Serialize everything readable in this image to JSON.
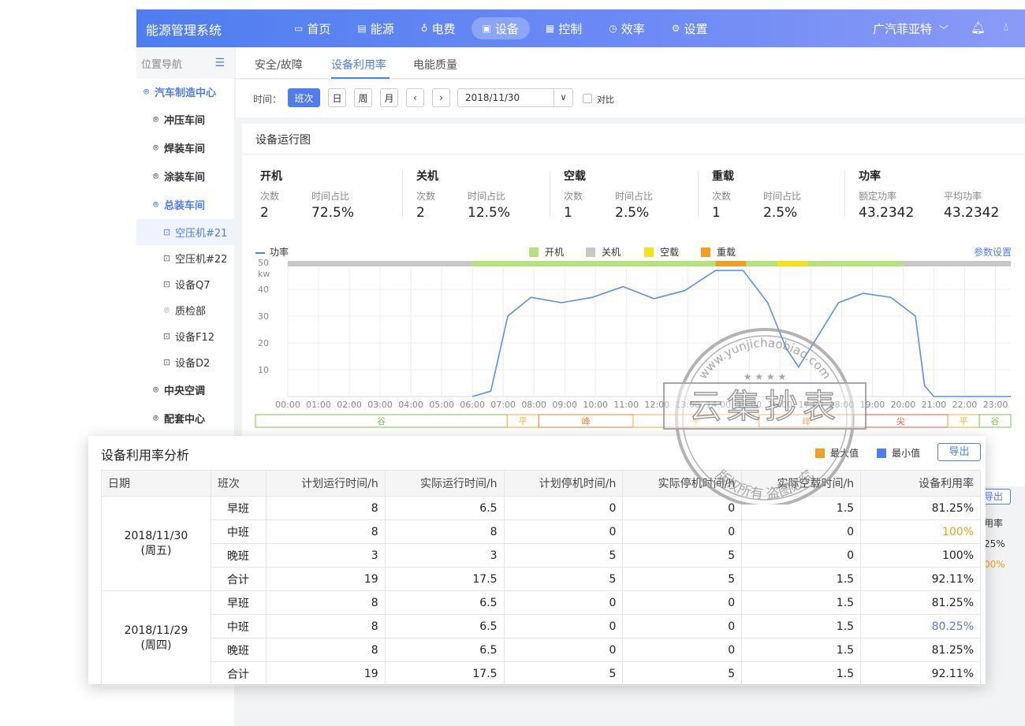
{
  "app": {
    "title": "能源管理系统",
    "nav": [
      {
        "label": "首页",
        "icon": "monitor-icon",
        "glyph": "▭"
      },
      {
        "label": "能源",
        "icon": "database-icon",
        "glyph": "▤"
      },
      {
        "label": "电费",
        "icon": "lightbulb-icon",
        "glyph": "♁"
      },
      {
        "label": "设备",
        "icon": "device-icon",
        "glyph": "▣"
      },
      {
        "label": "控制",
        "icon": "control-panel-icon",
        "glyph": "▦"
      },
      {
        "label": "效率",
        "icon": "clock-icon",
        "glyph": "◷"
      },
      {
        "label": "设置",
        "icon": "gear-icon",
        "glyph": "⚙"
      }
    ],
    "active_nav": "设备",
    "company": "广汽菲亚特",
    "company_caret": "﹀"
  },
  "sidebar": {
    "header": "位置导航",
    "collapse_glyph": "☰",
    "items": [
      {
        "label": "汽车制造中心",
        "type": "location"
      },
      {
        "label": "冲压车间",
        "type": "location"
      },
      {
        "label": "焊装车间",
        "type": "location"
      },
      {
        "label": "涂装车间",
        "type": "location"
      },
      {
        "label": "总装车间",
        "type": "location"
      },
      {
        "label": "空压机#21",
        "type": "device"
      },
      {
        "label": "空压机#22",
        "type": "device"
      },
      {
        "label": "设备Q7",
        "type": "device"
      },
      {
        "label": "质检部",
        "type": "location"
      },
      {
        "label": "设备F12",
        "type": "device"
      },
      {
        "label": "设备D2",
        "type": "device"
      },
      {
        "label": "中央空调",
        "type": "location"
      },
      {
        "label": "配套中心",
        "type": "location"
      }
    ]
  },
  "tabs": [
    "安全/故障",
    "设备利用率",
    "电能质量"
  ],
  "active_tab": "设备利用率",
  "filter": {
    "label": "时间：",
    "buttons": [
      "班次",
      "日",
      "周",
      "月"
    ],
    "active": "班次",
    "prev": "‹",
    "next": "›",
    "date": "2018/11/30",
    "date_caret": "∨",
    "compare_label": "对比"
  },
  "run_card": {
    "title": "设备运行图",
    "stats": [
      {
        "title": "开机",
        "sub1": "次数",
        "sub2": "时间占比",
        "val1": "2",
        "val2": "72.5%"
      },
      {
        "title": "关机",
        "sub1": "次数",
        "sub2": "时间占比",
        "val1": "2",
        "val2": "12.5%"
      },
      {
        "title": "空载",
        "sub1": "次数",
        "sub2": "时间占比",
        "val1": "1",
        "val2": "2.5%"
      },
      {
        "title": "重载",
        "sub1": "次数",
        "sub2": "时间占比",
        "val1": "1",
        "val2": "2.5%"
      },
      {
        "title": "功率",
        "sub1": "额定功率",
        "sub2": "平均功率",
        "val1": "43.2342",
        "val2": "43.2342"
      }
    ],
    "legend_power": "功率",
    "legend_states": [
      {
        "label": "开机",
        "color": "#b5e27c"
      },
      {
        "label": "关机",
        "color": "#c8c8c8"
      },
      {
        "label": "空载",
        "color": "#f6e21a"
      },
      {
        "label": "重载",
        "color": "#f0a020"
      }
    ],
    "param_link": "参数设置"
  },
  "chart_data": {
    "type": "line",
    "title": "设备运行图",
    "ylabel": "kw",
    "ylim": [
      0,
      50
    ],
    "yticks": [
      10,
      20,
      30,
      40,
      50
    ],
    "x": [
      "00:00",
      "01:00",
      "02:00",
      "03:00",
      "04:00",
      "05:00",
      "06:00",
      "07:00",
      "08:00",
      "09:00",
      "10:00",
      "11:00",
      "12:00",
      "13:00",
      "14:00",
      "15:00",
      "16:00",
      "17:00",
      "18:00",
      "19:00",
      "20:00",
      "21:00",
      "22:00",
      "23:00"
    ],
    "series": [
      {
        "name": "功率",
        "color": "#5b8ff0",
        "points": [
          [
            6.0,
            0
          ],
          [
            6.6,
            2
          ],
          [
            7.15,
            30
          ],
          [
            7.9,
            37
          ],
          [
            8.9,
            35
          ],
          [
            9.9,
            37
          ],
          [
            10.9,
            41
          ],
          [
            11.9,
            36.5
          ],
          [
            12.9,
            39.5
          ],
          [
            13.9,
            47
          ],
          [
            14.8,
            47
          ],
          [
            15.6,
            35
          ],
          [
            16.2,
            18
          ],
          [
            16.6,
            11
          ],
          [
            17.2,
            22
          ],
          [
            17.9,
            35
          ],
          [
            18.7,
            38.5
          ],
          [
            19.6,
            37
          ],
          [
            20.4,
            30
          ],
          [
            20.7,
            4
          ],
          [
            21,
            0
          ],
          [
            23.5,
            0
          ]
        ]
      }
    ],
    "state_bar": [
      {
        "state": "关机",
        "from": 0,
        "to": 6.0
      },
      {
        "state": "开机",
        "from": 6.0,
        "to": 13.9
      },
      {
        "state": "重载",
        "from": 13.9,
        "to": 14.9
      },
      {
        "state": "开机",
        "from": 14.9,
        "to": 15.9
      },
      {
        "state": "空载",
        "from": 15.9,
        "to": 16.9
      },
      {
        "state": "开机",
        "from": 16.9,
        "to": 20.0
      },
      {
        "state": "关机",
        "from": 20.0,
        "to": 23.5
      }
    ],
    "tariff_bands": [
      {
        "label": "谷",
        "from": 0,
        "to": 8,
        "color": "#7cc44a"
      },
      {
        "label": "平",
        "from": 8,
        "to": 9,
        "color": "#f0b030"
      },
      {
        "label": "峰",
        "from": 9,
        "to": 12,
        "color": "#f08030"
      },
      {
        "label": "平",
        "from": 12,
        "to": 16,
        "color": "#f0b030"
      },
      {
        "label": "峰",
        "from": 16,
        "to": 19,
        "color": "#f08030"
      },
      {
        "label": "尖",
        "from": 19,
        "to": 22,
        "color": "#e45a4a"
      },
      {
        "label": "平",
        "from": 22,
        "to": 23,
        "color": "#f0b030"
      },
      {
        "label": "谷",
        "from": 23,
        "to": 24,
        "color": "#7cc44a"
      }
    ]
  },
  "utilization": {
    "title": "设备利用率分析",
    "legend": [
      {
        "label": "最大值",
        "color": "#f0a020"
      },
      {
        "label": "最小值",
        "color": "#4f7df0"
      }
    ],
    "export_label": "导出",
    "columns": [
      "日期",
      "班次",
      "计划运行时间/h",
      "实际运行时间/h",
      "计划停机时间/h",
      "实际停机时间/h",
      "实际空载时间/h",
      "设备利用率"
    ],
    "groups": [
      {
        "date": "2018/11/30",
        "weekday": "(周五)",
        "rows": [
          {
            "shift": "早班",
            "vals": [
              "8",
              "6.5",
              "0",
              "0",
              "1.5"
            ],
            "rate": "81.25%",
            "mark": ""
          },
          {
            "shift": "中班",
            "vals": [
              "8",
              "8",
              "0",
              "0",
              "0"
            ],
            "rate": "100%",
            "mark": "max"
          },
          {
            "shift": "晚班",
            "vals": [
              "3",
              "3",
              "5",
              "5",
              "0"
            ],
            "rate": "100%",
            "mark": ""
          },
          {
            "shift": "合计",
            "vals": [
              "19",
              "17.5",
              "5",
              "5",
              "1.5"
            ],
            "rate": "92.11%",
            "mark": ""
          }
        ]
      },
      {
        "date": "2018/11/29",
        "weekday": "(周四)",
        "rows": [
          {
            "shift": "早班",
            "vals": [
              "8",
              "6.5",
              "0",
              "0",
              "1.5"
            ],
            "rate": "81.25%",
            "mark": ""
          },
          {
            "shift": "中班",
            "vals": [
              "8",
              "6.5",
              "0",
              "0",
              "1.5"
            ],
            "rate": "80.25%",
            "mark": "min"
          },
          {
            "shift": "晚班",
            "vals": [
              "8",
              "6.5",
              "0",
              "0",
              "1.5"
            ],
            "rate": "81.25%",
            "mark": ""
          },
          {
            "shift": "合计",
            "vals": [
              "19",
              "17.5",
              "5",
              "5",
              "1.5"
            ],
            "rate": "92.11%",
            "mark": ""
          }
        ]
      }
    ],
    "peek": {
      "export": "导出",
      "header": "用率",
      "v1": "25%",
      "v2": "00%"
    }
  },
  "watermark": {
    "big_text": "云集抄表",
    "arc_text": "www.yunjichaobiao.com",
    "sub_text": "版权所有 盗图必究"
  }
}
